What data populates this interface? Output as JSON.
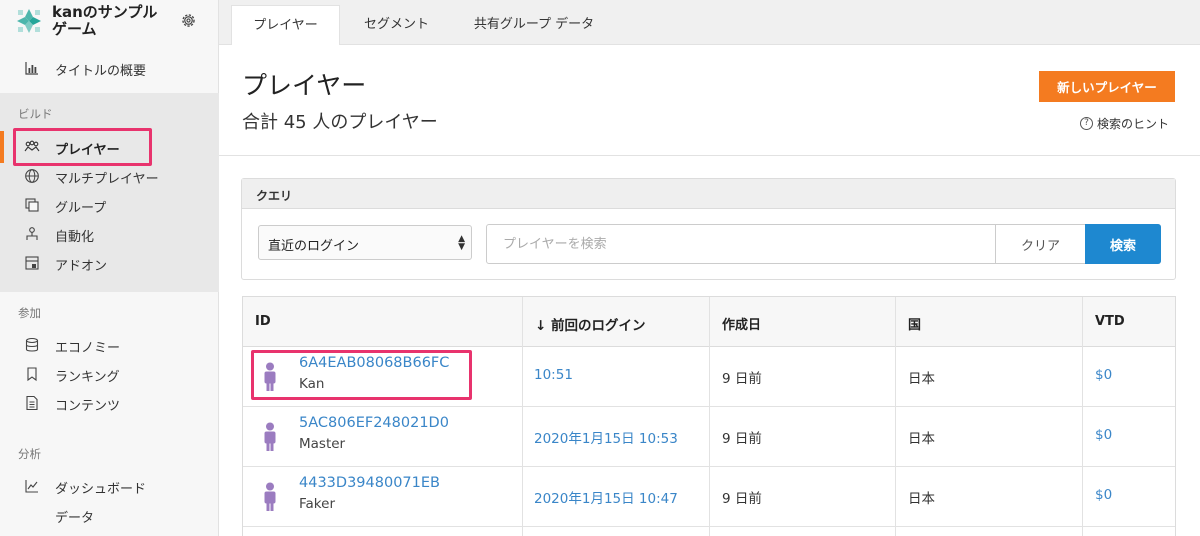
{
  "brand": {
    "title": "kanのサンプルゲーム",
    "logo_icon": "game-logo-icon",
    "settings_icon": "gear-icon"
  },
  "sidebar": {
    "top_item": {
      "label": "タイトルの概要",
      "icon": "bar-chart-icon"
    },
    "sections": [
      {
        "label": "ビルド",
        "items": [
          {
            "label": "プレイヤー",
            "icon": "players-icon",
            "active": true
          },
          {
            "label": "マルチプレイヤー",
            "icon": "globe-icon"
          },
          {
            "label": "グループ",
            "icon": "group-icon"
          },
          {
            "label": "自動化",
            "icon": "automation-icon"
          },
          {
            "label": "アドオン",
            "icon": "addon-icon"
          }
        ]
      },
      {
        "label": "参加",
        "items": [
          {
            "label": "エコノミー",
            "icon": "database-icon"
          },
          {
            "label": "ランキング",
            "icon": "bookmark-icon"
          },
          {
            "label": "コンテンツ",
            "icon": "document-icon"
          }
        ]
      },
      {
        "label": "分析",
        "items": [
          {
            "label": "ダッシュボード",
            "icon": "dashboard-icon"
          },
          {
            "label": "データ",
            "icon": ""
          }
        ]
      }
    ]
  },
  "tabs": [
    {
      "label": "プレイヤー",
      "active": true
    },
    {
      "label": "セグメント",
      "active": false
    },
    {
      "label": "共有グループ データ",
      "active": false
    }
  ],
  "header": {
    "title": "プレイヤー",
    "subtitle": "合計 45 人のプレイヤー",
    "new_button": "新しいプレイヤー",
    "hint_label": "検索のヒント",
    "hint_icon": "question-circle-icon"
  },
  "query": {
    "title": "クエリ",
    "sort_value": "直近のログイン",
    "search_placeholder": "プレイヤーを検索",
    "clear_label": "クリア",
    "search_label": "検索"
  },
  "table": {
    "columns": [
      "ID",
      "↓ 前回のログイン",
      "作成日",
      "国",
      "VTD"
    ],
    "rows": [
      {
        "id": "6A4EAB08068B66FC",
        "name": "Kan",
        "last_login": "10:51",
        "created": "9 日前",
        "country": "日本",
        "vtd": "$0"
      },
      {
        "id": "5AC806EF248021D0",
        "name": "Master",
        "last_login": "2020年1月15日 10:53",
        "created": "9 日前",
        "country": "日本",
        "vtd": "$0"
      },
      {
        "id": "4433D39480071EB",
        "name": "Faker",
        "last_login": "2020年1月15日 10:47",
        "created": "9 日前",
        "country": "日本",
        "vtd": "$0"
      }
    ]
  },
  "colors": {
    "accent_orange": "#f47b20",
    "primary_blue": "#1e88d0",
    "link_blue": "#3a86c8",
    "highlight_pink": "#e8336d",
    "avatar_purple": "#9b7cc0"
  }
}
